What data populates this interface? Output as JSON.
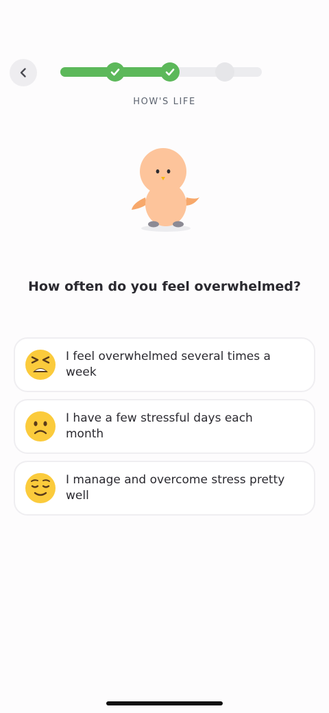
{
  "header": {
    "section_label": "HOW'S LIFE",
    "progress": {
      "completed_steps": 2,
      "total_steps": 3
    }
  },
  "question": "How often do you feel overwhelmed?",
  "options": [
    {
      "label": "I feel overwhelmed several times a week",
      "icon": "tired-face-emoji-icon"
    },
    {
      "label": "I have a few stressful days each month",
      "icon": "frowning-face-emoji-icon"
    },
    {
      "label": "I manage and overcome stress pretty well",
      "icon": "relieved-face-emoji-icon"
    }
  ],
  "colors": {
    "accent_green": "#5cb85a",
    "emoji_yellow": "#fbcb3c",
    "text": "#2b2a30"
  }
}
